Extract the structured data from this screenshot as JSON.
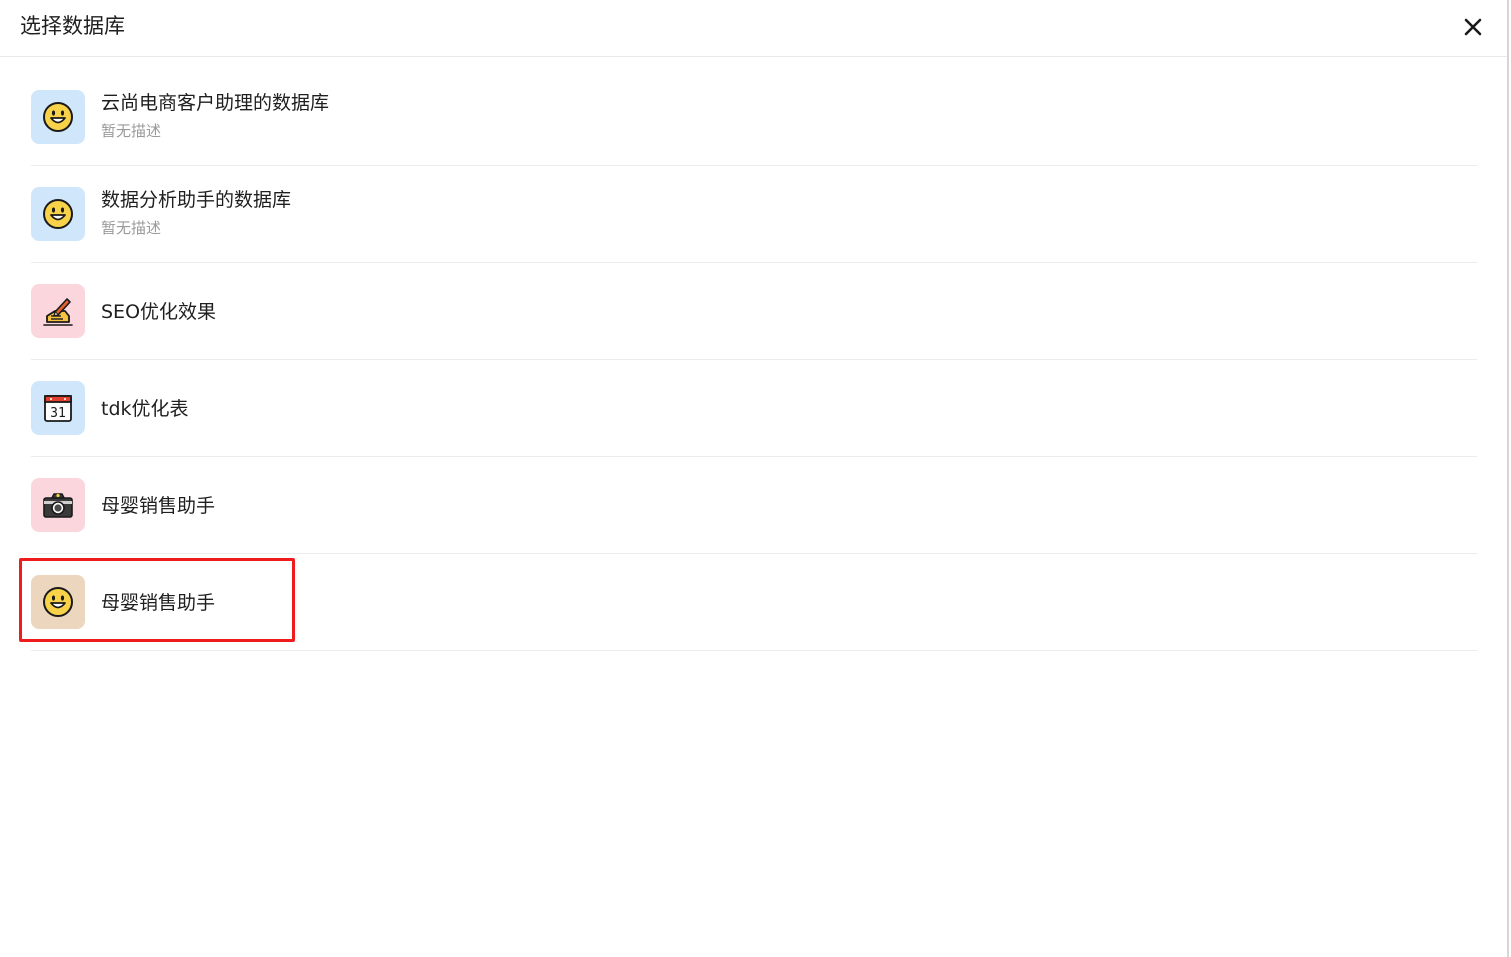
{
  "dialog": {
    "title": "选择数据库"
  },
  "items": [
    {
      "name": "云尚电商客户助理的数据库",
      "desc": "暂无描述",
      "icon": "smiley-face-icon",
      "bg": "#cfe6fb"
    },
    {
      "name": "数据分析助手的数据库",
      "desc": "暂无描述",
      "icon": "smiley-face-icon",
      "bg": "#cfe6fb"
    },
    {
      "name": "SEO优化效果",
      "icon": "writing-hand-icon",
      "bg": "#fcd6dd"
    },
    {
      "name": "tdk优化表",
      "icon": "calendar-icon",
      "bg": "#cfe6fb"
    },
    {
      "name": "母婴销售助手",
      "icon": "camera-icon",
      "bg": "#fcd6dd"
    },
    {
      "name": "母婴销售助手",
      "icon": "smiley-face-icon",
      "bg": "#ecd6be"
    }
  ],
  "calendar_day": "31",
  "colors": {
    "highlight": "#ee1c1c",
    "accent_blue": "#cfe6fb",
    "accent_pink": "#fcd6dd",
    "accent_tan": "#ecd6be"
  }
}
